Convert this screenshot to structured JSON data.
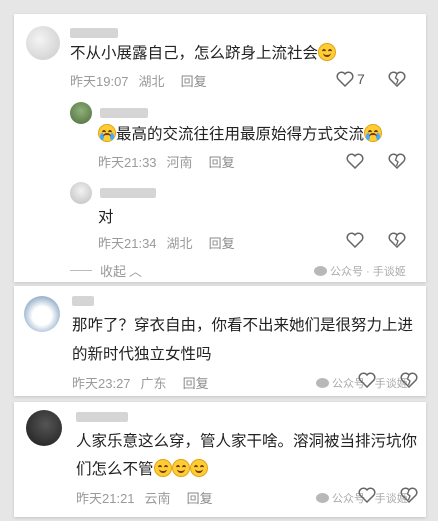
{
  "comments": [
    {
      "text": "不从小展露自己，怎么跻身上流社会",
      "time": "昨天19:07",
      "location": "湖北",
      "reply_label": "回复",
      "like_count": "7",
      "replies": [
        {
          "text_main": "最高的交流往往用最原始得方式交流",
          "time": "昨天21:33",
          "location": "河南",
          "reply_label": "回复"
        },
        {
          "text": "对",
          "time": "昨天21:34",
          "location": "湖北",
          "reply_label": "回复"
        }
      ],
      "collapse_label": "收起",
      "watermark": "公众号 · 手谈姬"
    },
    {
      "text_line1": "那咋了？穿衣自由，你看不出来她们是很努力上进",
      "text_line2": "的新时代独立女性吗",
      "time": "昨天23:27",
      "location": "广东",
      "reply_label": "回复",
      "watermark": "公众号 · 手谈姬"
    },
    {
      "text_line1": "人家乐意这么穿，管人家干啥。溶洞被当排污坑你",
      "text_line2": "们怎么不管",
      "time": "昨天21:21",
      "location": "云南",
      "reply_label": "回复",
      "watermark": "公众号 · 手谈姬"
    }
  ],
  "icons": {
    "like": "heart-icon",
    "dislike": "broken-heart-icon",
    "emoji_smile": "smile-emoji",
    "emoji_cry": "crying-emoji"
  },
  "colors": {
    "text": "#222222",
    "meta": "#9a9a9a",
    "background": "#e6e6e6"
  }
}
